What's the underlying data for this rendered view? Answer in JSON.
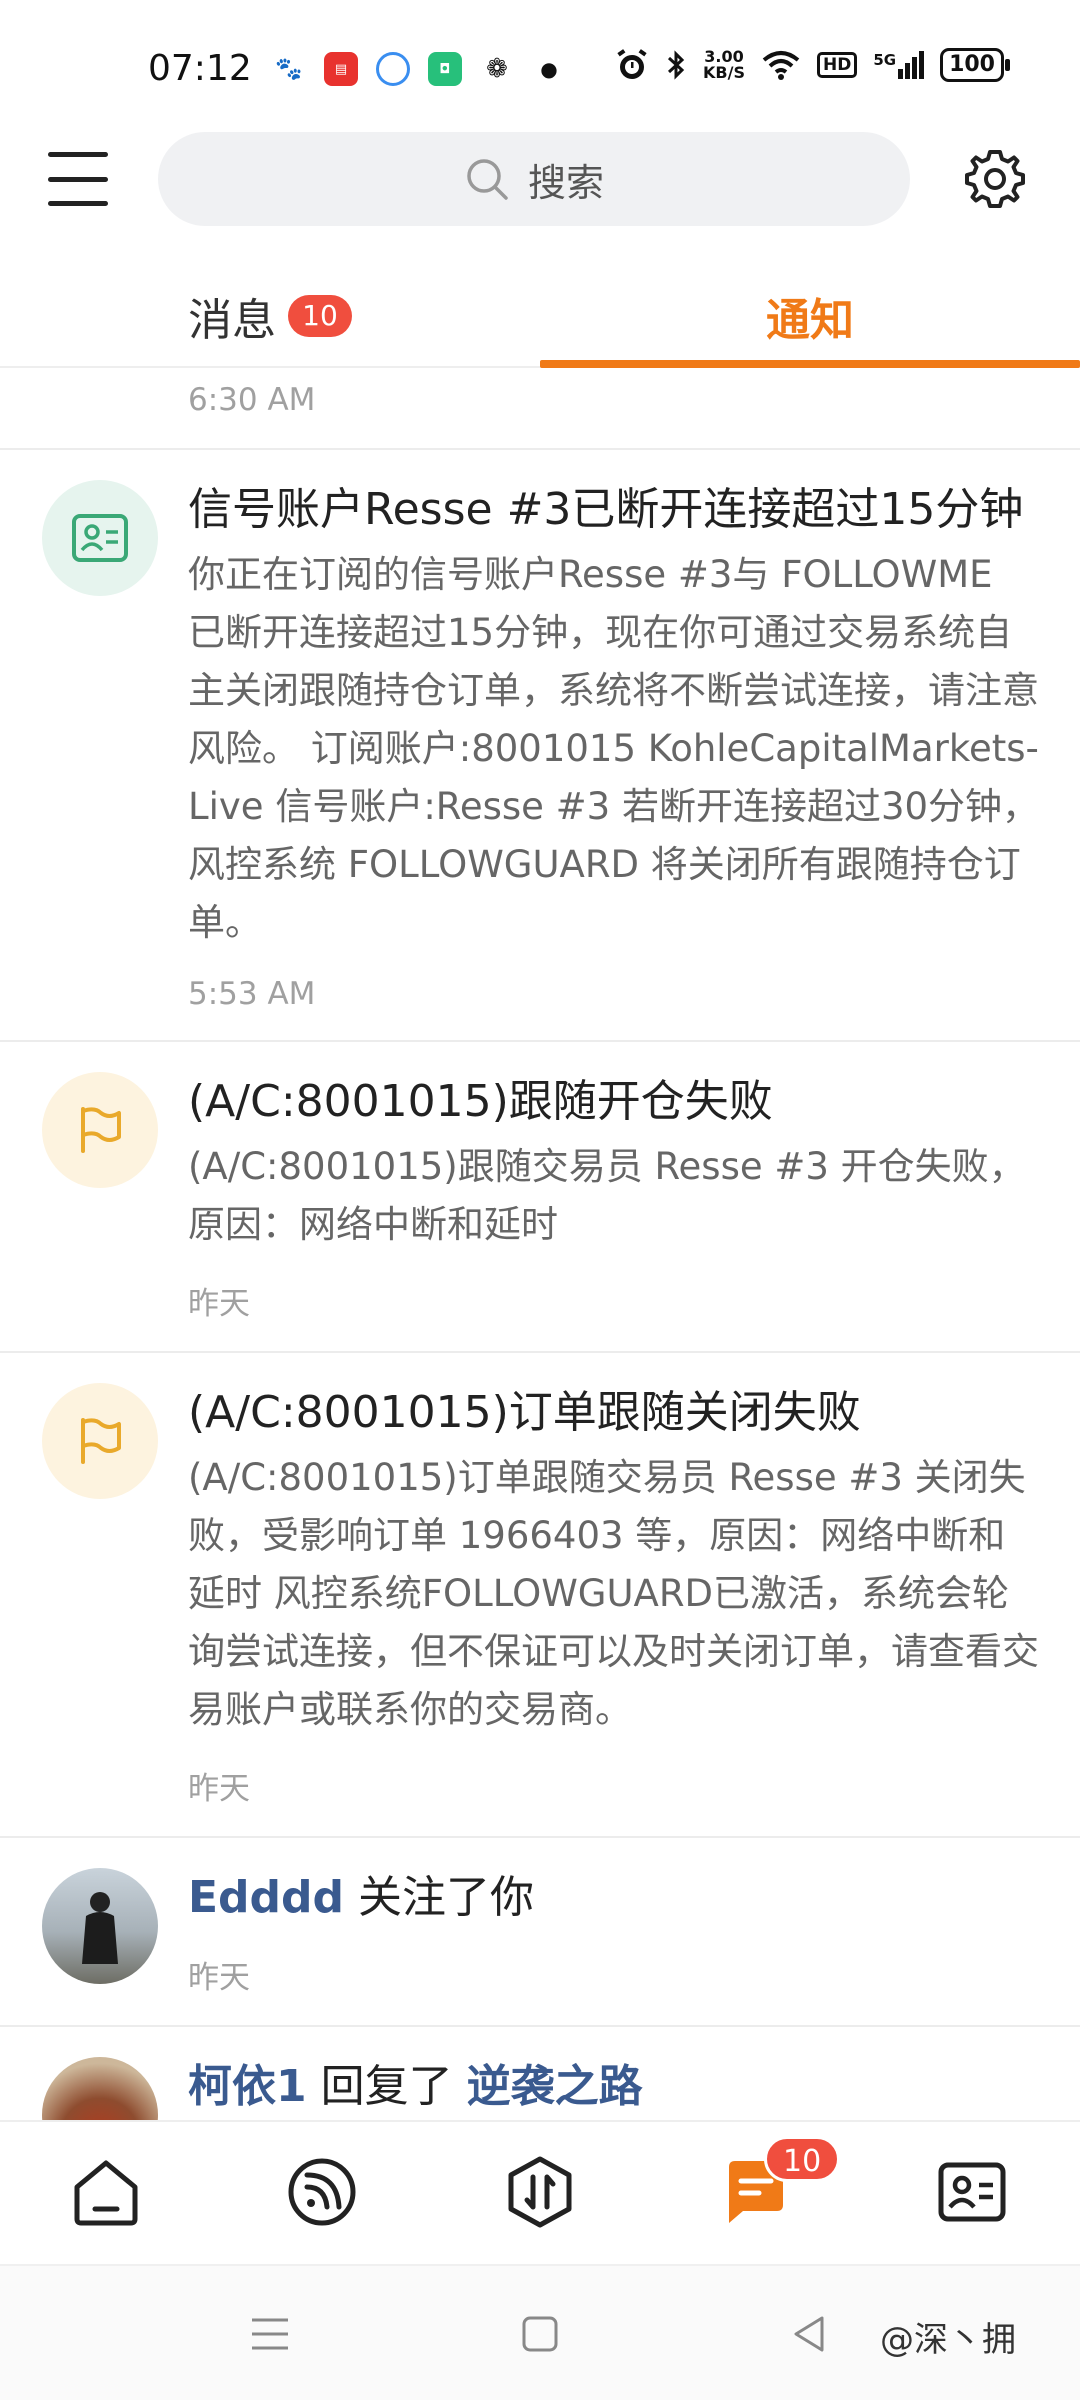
{
  "status_bar": {
    "time": "07:12",
    "app_icons": [
      "baidu-icon",
      "toutiao-icon",
      "browser-icon",
      "store-icon",
      "wechat-icon"
    ],
    "net_speed_value": "3.00",
    "net_speed_unit": "KB/S",
    "hd_label": "HD",
    "network_label": "5G",
    "battery": "100"
  },
  "header": {
    "search_placeholder": "搜索"
  },
  "tabs": {
    "messages_label": "消息",
    "messages_badge": "10",
    "notifications_label": "通知"
  },
  "prev_item_time": "6:30 AM",
  "notifications": [
    {
      "icon": "id-card-icon",
      "title": "信号账户Resse #3已断开连接超过15分钟",
      "body": "你正在订阅的信号账户Resse #3与 FOLLOWME 已断开连接超过15分钟，现在你可通过交易系统自主关闭跟随持仓订单，系统将不断尝试连接，请注意风险。 订阅账户:8001015 KohleCapitalMarkets-Live 信号账户:Resse #3 若断开连接超过30分钟，风控系统 FOLLOWGUARD 将关闭所有跟随持仓订单。",
      "time": "5:53 AM"
    },
    {
      "icon": "flag-icon",
      "title": "(A/C:8001015)跟随开仓失败",
      "body": "(A/C:8001015)跟随交易员 Resse #3 开仓失败，原因：网络中断和延时",
      "time": "昨天"
    },
    {
      "icon": "flag-icon",
      "title": "(A/C:8001015)订单跟随关闭失败",
      "body": "(A/C:8001015)订单跟随交易员 Resse #3 关闭失败，受影响订单 1966403 等，原因：网络中断和延时 风控系统FOLLOWGUARD已激活，系统会轮询尝试连接，但不保证可以及时关闭订单，请查看交易账户或联系你的交易商。",
      "time": "昨天"
    }
  ],
  "social": [
    {
      "user": "Edddd",
      "action": "关注了你",
      "target": "",
      "time": "昨天"
    },
    {
      "user": "柯依1",
      "action": "回复了",
      "target": "逆袭之路",
      "time": ""
    }
  ],
  "bottom_nav": {
    "items": [
      "home-icon",
      "feed-icon",
      "trade-icon",
      "messages-icon",
      "profile-icon"
    ],
    "messages_badge": "10"
  },
  "watermark": "@深丶拥",
  "colors": {
    "accent": "#f07a17",
    "badge": "#f04e3e",
    "link": "#3a5a8f",
    "green_icon": "#3aa876",
    "yellow_icon": "#e9a92b"
  }
}
